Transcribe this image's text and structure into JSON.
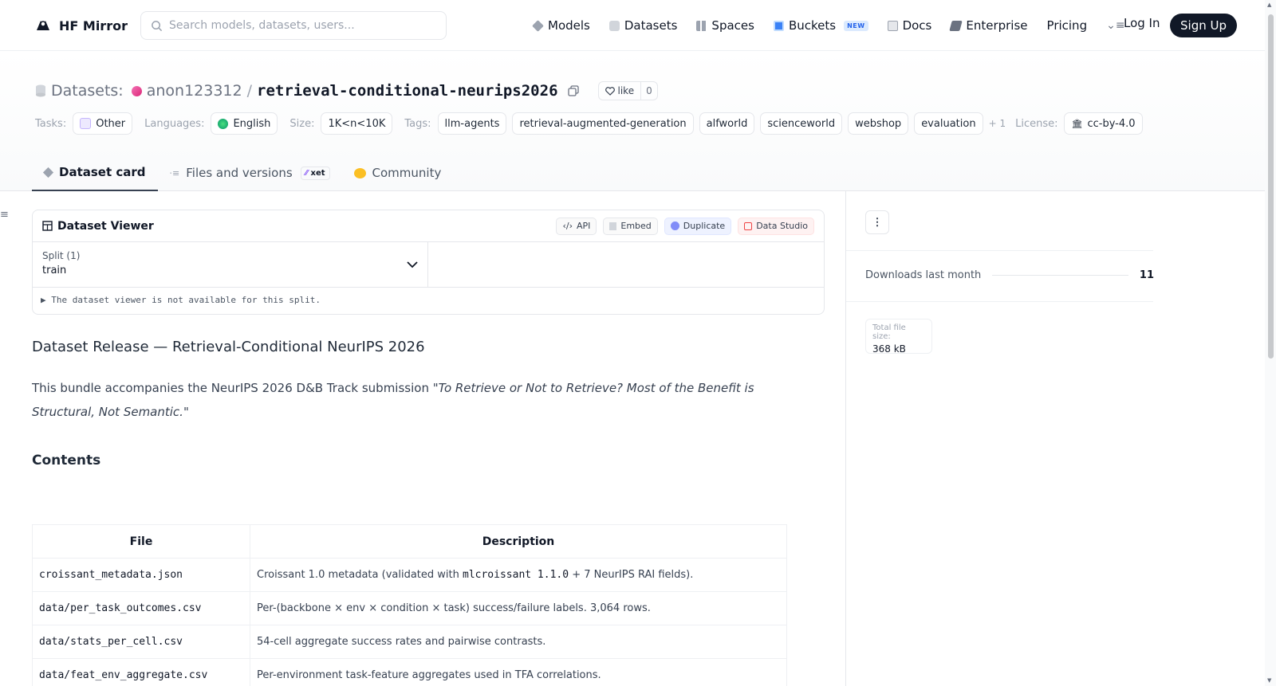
{
  "nav": {
    "brand": "HF Mirror",
    "search_placeholder": "Search models, datasets, users...",
    "items": [
      {
        "label": "Models",
        "icon": "models-icon",
        "color": "#9ca3af"
      },
      {
        "label": "Datasets",
        "icon": "datasets-icon",
        "color": "#9ca3af"
      },
      {
        "label": "Spaces",
        "icon": "spaces-icon",
        "color": "#9ca3af"
      },
      {
        "label": "Buckets",
        "icon": "buckets-icon",
        "color": "#3b82f6",
        "badge": "NEW"
      },
      {
        "label": "Docs",
        "icon": "docs-icon",
        "color": "#9ca3af"
      },
      {
        "label": "Enterprise",
        "icon": "enterprise-icon",
        "color": "#6b7280"
      },
      {
        "label": "Pricing",
        "icon": "",
        "color": ""
      }
    ],
    "login": "Log In",
    "signup": "Sign Up"
  },
  "header": {
    "kind": "Datasets:",
    "owner": "anon123312",
    "repo": "retrieval-conditional-neurips2026",
    "like_label": "like",
    "like_count": "0",
    "tasks_label": "Tasks:",
    "task": "Other",
    "languages_label": "Languages:",
    "language": "English",
    "size_label": "Size:",
    "size": "1K<n<10K",
    "tags_label": "Tags:",
    "tags": [
      "llm-agents",
      "retrieval-augmented-generation",
      "alfworld",
      "scienceworld",
      "webshop",
      "evaluation"
    ],
    "more_tags": "+ 1",
    "license_label": "License:",
    "license": "cc-by-4.0"
  },
  "tabs": [
    {
      "label": "Dataset card",
      "active": true
    },
    {
      "label": "Files and versions",
      "badge": "xet"
    },
    {
      "label": "Community"
    }
  ],
  "viewer": {
    "title": "Dataset Viewer",
    "actions": [
      "API",
      "Embed",
      "Duplicate",
      "Data Studio"
    ],
    "split_label": "Split (1)",
    "split_value": "train",
    "notice": "The dataset viewer is not available for this split."
  },
  "card": {
    "heading": "Dataset Release — Retrieval-Conditional NeurIPS 2026",
    "para_prefix": "This bundle accompanies the NeurIPS 2026 D&B Track submission ",
    "para_quote": "\"To Retrieve or Not to Retrieve? Most of the Benefit is Structural, Not Semantic.\"",
    "contents_heading": "Contents",
    "table_headers": [
      "File",
      "Description"
    ],
    "rows": [
      {
        "file": "croissant_metadata.json",
        "desc_pre": "Croissant 1.0 metadata (validated with ",
        "desc_code": "mlcroissant 1.1.0",
        "desc_post": " + 7 NeurIPS RAI fields)."
      },
      {
        "file": "data/per_task_outcomes.csv",
        "desc_pre": "Per-(backbone × env × condition × task) success/failure labels. 3,064 rows.",
        "desc_code": "",
        "desc_post": ""
      },
      {
        "file": "data/stats_per_cell.csv",
        "desc_pre": "54-cell aggregate success rates and pairwise contrasts.",
        "desc_code": "",
        "desc_post": ""
      },
      {
        "file": "data/feat_env_aggregate.csv",
        "desc_pre": "Per-environment task-feature aggregates used in TFA correlations.",
        "desc_code": "",
        "desc_post": ""
      }
    ]
  },
  "sidebar": {
    "downloads_label": "Downloads last month",
    "downloads_value": "11",
    "size_label": "Total file size:",
    "size_value": "368 kB"
  }
}
